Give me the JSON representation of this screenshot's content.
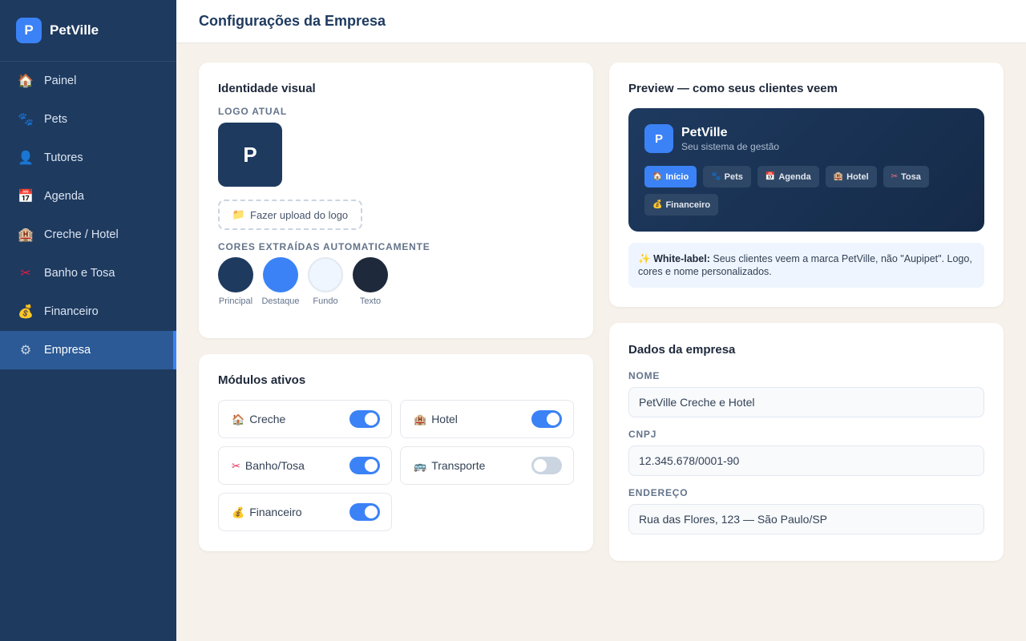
{
  "app": {
    "name": "PetVille",
    "logo_letter": "P"
  },
  "sidebar": {
    "items": [
      {
        "icon": "🏠",
        "icon_name": "house-icon",
        "label": "Painel",
        "active": false
      },
      {
        "icon": "🐾",
        "icon_name": "paw-icon",
        "label": "Pets",
        "active": false
      },
      {
        "icon": "👤",
        "icon_name": "person-icon",
        "label": "Tutores",
        "active": false
      },
      {
        "icon": "📅",
        "icon_name": "calendar-icon",
        "label": "Agenda",
        "active": false
      },
      {
        "icon": "🏨",
        "icon_name": "hotel-icon",
        "label": "Creche / Hotel",
        "active": false
      },
      {
        "icon": "✂",
        "icon_name": "scissors-icon",
        "label": "Banho e Tosa",
        "active": false
      },
      {
        "icon": "💰",
        "icon_name": "money-bag-icon",
        "label": "Financeiro",
        "active": false
      },
      {
        "icon": "⚙",
        "icon_name": "gear-icon",
        "label": "Empresa",
        "active": true
      }
    ]
  },
  "header": {
    "title": "Configurações da Empresa"
  },
  "identity": {
    "title": "Identidade visual",
    "logo_label": "LOGO ATUAL",
    "logo_letter": "P",
    "upload_icon": "📁",
    "upload_label": "Fazer upload do logo",
    "colors_label": "CORES EXTRAÍDAS AUTOMATICAMENTE",
    "swatches": [
      {
        "label": "Principal",
        "color": "#1e3a5f"
      },
      {
        "label": "Destaque",
        "color": "#3b82f6"
      },
      {
        "label": "Fundo",
        "color": "#eff6ff"
      },
      {
        "label": "Texto",
        "color": "#1e293b"
      }
    ]
  },
  "modules": {
    "title": "Módulos ativos",
    "items": [
      {
        "icon": "🏠",
        "icon_name": "house-icon",
        "label": "Creche",
        "enabled": true
      },
      {
        "icon": "🏨",
        "icon_name": "hotel-icon",
        "label": "Hotel",
        "enabled": true
      },
      {
        "icon": "✂",
        "icon_name": "scissors-icon",
        "label": "Banho/Tosa",
        "enabled": true
      },
      {
        "icon": "🚌",
        "icon_name": "bus-icon",
        "label": "Transporte",
        "enabled": false
      },
      {
        "icon": "💰",
        "icon_name": "money-bag-icon",
        "label": "Financeiro",
        "enabled": true
      }
    ]
  },
  "preview": {
    "title": "Preview — como seus clientes veem",
    "brand_name": "PetVille",
    "brand_sub": "Seu sistema de gestão",
    "logo_letter": "P",
    "chips": [
      {
        "icon": "🏠",
        "icon_name": "house-icon",
        "label": "Início",
        "active": true
      },
      {
        "icon": "🐾",
        "icon_name": "paw-icon",
        "label": "Pets",
        "active": false
      },
      {
        "icon": "📅",
        "icon_name": "calendar-icon",
        "label": "Agenda",
        "active": false
      },
      {
        "icon": "🏨",
        "icon_name": "hotel-icon",
        "label": "Hotel",
        "active": false
      },
      {
        "icon": "✂",
        "icon_name": "scissors-icon",
        "label": "Tosa",
        "active": false
      },
      {
        "icon": "💰",
        "icon_name": "money-bag-icon",
        "label": "Financeiro",
        "active": false
      }
    ],
    "note_icon": "✨",
    "note_bold": "White-label:",
    "note_text": " Seus clientes veem a marca PetVille, não \"Aupipet\". Logo, cores e nome personalizados."
  },
  "company": {
    "title": "Dados da empresa",
    "fields": [
      {
        "label": "NOME",
        "value": "PetVille Creche e Hotel"
      },
      {
        "label": "CNPJ",
        "value": "12.345.678/0001-90"
      },
      {
        "label": "ENDEREÇO",
        "value": "Rua das Flores, 123 — São Paulo/SP"
      }
    ]
  },
  "colors": {
    "sidebar_bg": "#1e3a5f",
    "accent": "#3b82f6",
    "page_bg": "#f6f1ea"
  }
}
